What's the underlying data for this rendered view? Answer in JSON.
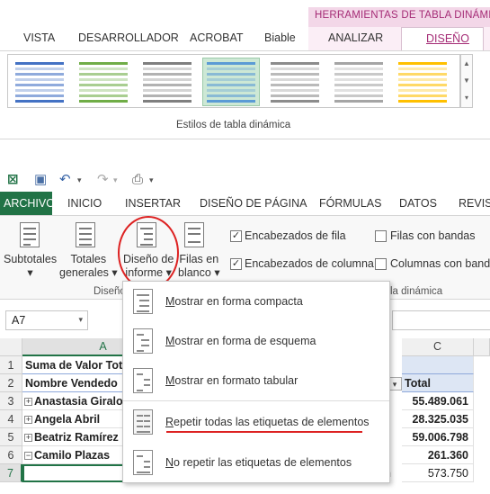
{
  "top_ribbon": {
    "context_banner": "HERRAMIENTAS DE TABLA DINÁMICA",
    "tabs": [
      "VISTA",
      "DESARROLLADOR",
      "ACROBAT",
      "Biable",
      "ANALIZAR",
      "DISEÑO"
    ],
    "group_label": "Estilos de tabla dinámica",
    "style_colors": [
      "#4472c4",
      "#70ad47",
      "#7f7f7f",
      "#5b9bd5",
      "#8c8c8c",
      "#a5a5a5",
      "#ffc000"
    ]
  },
  "main_tabs": [
    "ARCHIVO",
    "INICIO",
    "INSERTAR",
    "DISEÑO DE PÁGINA",
    "FÓRMULAS",
    "DATOS",
    "REVISA"
  ],
  "ribbon": {
    "subtotales": "Subtotales",
    "totales_1": "Totales",
    "totales_2": "generales",
    "diseno_1": "Diseño de",
    "diseno_2": "informe",
    "filas_1": "Filas en",
    "filas_2": "blanco",
    "group_diseno": "Diseño",
    "group_opciones": "la dinámica",
    "checks": [
      {
        "label": "Encabezados de fila",
        "checked": true
      },
      {
        "label": "Encabezados de columna",
        "checked": true
      },
      {
        "label": "Filas con bandas",
        "checked": false
      },
      {
        "label": "Columnas con banda",
        "checked": false
      }
    ]
  },
  "namebox": {
    "value": "A7"
  },
  "grid": {
    "col_a": "A",
    "col_c": "C",
    "rows": [
      "1",
      "2",
      "3",
      "4",
      "5",
      "6",
      "7"
    ],
    "a1": "Suma de Valor Tot",
    "a2": "Nombre Vendedo",
    "a3": "Anastasia Giralo",
    "a4": "Angela Abril",
    "a5": "Beatriz Ramírez",
    "a6": "Camilo Plazas",
    "c2": "Total",
    "c3": "55.489.061",
    "c4": "28.325.035",
    "c5": "59.006.798",
    "c6": "261.360",
    "c7": "573.750",
    "b7_fragment": "n"
  },
  "menu": {
    "items": [
      {
        "underline": "M",
        "rest": "ostrar en forma compacta"
      },
      {
        "underline": "M",
        "rest": "ostrar en forma de esquema"
      },
      {
        "underline": "M",
        "rest": "ostrar en formato tabular"
      },
      {
        "underline": "R",
        "rest": "epetir todas las etiquetas de elementos"
      },
      {
        "underline": "N",
        "rest": "o repetir las etiquetas de elementos"
      }
    ]
  }
}
